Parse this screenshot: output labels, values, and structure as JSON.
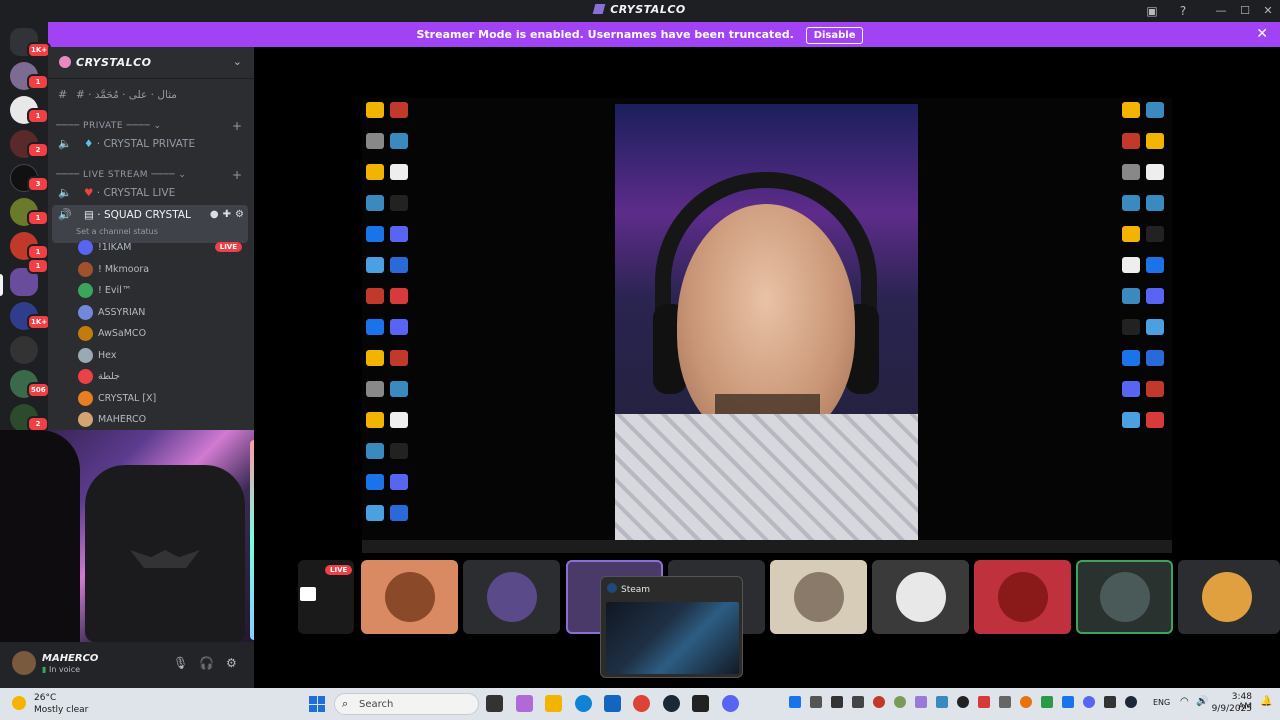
{
  "window": {
    "title": "CRYSTALCO"
  },
  "banner": {
    "text": "Streamer Mode is enabled. Usernames have been truncated.",
    "disable_label": "Disable"
  },
  "rail": {
    "badges": [
      "1K+",
      "1",
      "1",
      "2",
      "3",
      "1",
      "1",
      "1",
      "1K+",
      "506",
      "2",
      "1"
    ]
  },
  "server": {
    "name": "CRYSTALCO"
  },
  "channels": {
    "rules": "# · مثال · على · مُحَمَّد",
    "cat_private": "PRIVATE",
    "private_channel": "CRYSTAL PRIVATE",
    "cat_live": "LIVE STREAM",
    "live_channel": "CRYSTAL LIVE",
    "squad_channel": "SQUAD CRYSTAL",
    "squad_status": "Set a channel status"
  },
  "voice_users": [
    {
      "name": "!1IKAM",
      "live": "LIVE",
      "color": "#5865f2"
    },
    {
      "name": "! Mkmoora",
      "color": "#a0522d"
    },
    {
      "name": "! Evil™",
      "color": "#3ba55c"
    },
    {
      "name": "ASSYRIAN",
      "color": "#7289da"
    },
    {
      "name": "AwSaMCO",
      "color": "#c27c0e"
    },
    {
      "name": "Hex",
      "color": "#99aab5"
    },
    {
      "name": "جلطة",
      "color": "#ed4245"
    },
    {
      "name": "CRYSTAL [X]",
      "color": "#e67e22"
    },
    {
      "name": "MAHERCO",
      "color": "#d4a373"
    }
  ],
  "user_panel": {
    "name": "MAHERCO",
    "status": "In voice"
  },
  "stage": {
    "tile_live": "LIVE"
  },
  "steam_preview": {
    "title": "Steam"
  },
  "taskbar": {
    "temp": "26°C",
    "condition": "Mostly clear",
    "search_label": "Search",
    "lang": "ENG",
    "time": "3:48 AM",
    "date": "9/9/2025"
  }
}
